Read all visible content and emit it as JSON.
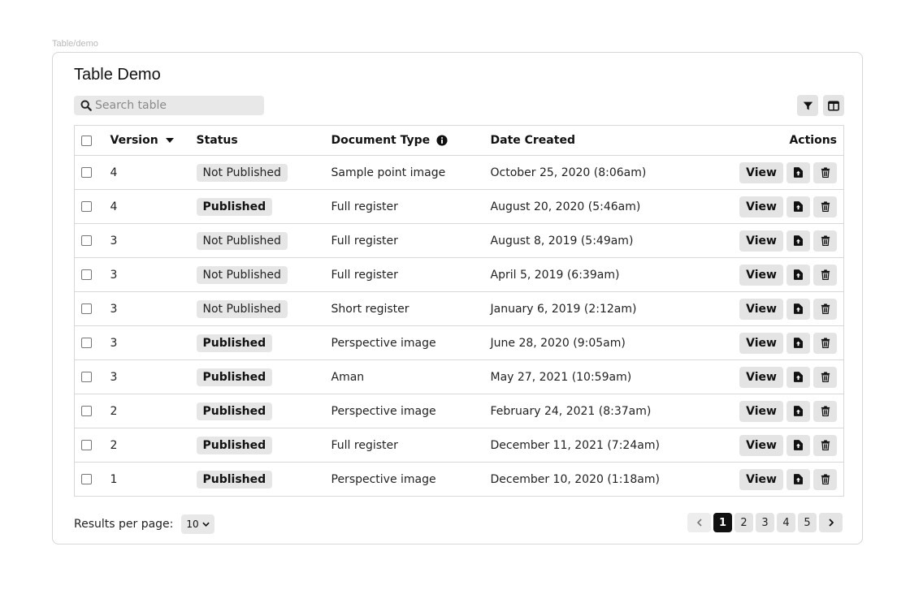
{
  "breadcrumb": "Table/demo",
  "title": "Table Demo",
  "search": {
    "placeholder": "Search table",
    "value": ""
  },
  "toolbar": {
    "filter_icon": "filter-icon",
    "columns_icon": "columns-icon"
  },
  "table": {
    "headers": {
      "version": "Version",
      "status": "Status",
      "document_type": "Document Type",
      "date_created": "Date Created",
      "actions": "Actions"
    },
    "sort": {
      "column": "version",
      "direction": "descending"
    },
    "view_label": "View",
    "rows": [
      {
        "version": "4",
        "status": "Not Published",
        "document_type": "Sample point image",
        "date_created": "October 25, 2020 (8:06am)"
      },
      {
        "version": "4",
        "status": "Published",
        "document_type": "Full register",
        "date_created": "August 20, 2020 (5:46am)"
      },
      {
        "version": "3",
        "status": "Not Published",
        "document_type": "Full register",
        "date_created": "August 8, 2019 (5:49am)"
      },
      {
        "version": "3",
        "status": "Not Published",
        "document_type": "Full register",
        "date_created": "April 5, 2019 (6:39am)"
      },
      {
        "version": "3",
        "status": "Not Published",
        "document_type": "Short register",
        "date_created": "January 6, 2019 (2:12am)"
      },
      {
        "version": "3",
        "status": "Published",
        "document_type": "Perspective image",
        "date_created": "June 28, 2020 (9:05am)"
      },
      {
        "version": "3",
        "status": "Published",
        "document_type": "Aman",
        "date_created": "May 27, 2021 (10:59am)"
      },
      {
        "version": "2",
        "status": "Published",
        "document_type": "Perspective image",
        "date_created": "February 24, 2021 (8:37am)"
      },
      {
        "version": "2",
        "status": "Published",
        "document_type": "Full register",
        "date_created": "December 11, 2021 (7:24am)"
      },
      {
        "version": "1",
        "status": "Published",
        "document_type": "Perspective image",
        "date_created": "December 10, 2020 (1:18am)"
      }
    ]
  },
  "footer": {
    "results_per_page_label": "Results per page:",
    "results_per_page_value": "10",
    "pages": [
      "1",
      "2",
      "3",
      "4",
      "5"
    ],
    "current_page": "1"
  }
}
